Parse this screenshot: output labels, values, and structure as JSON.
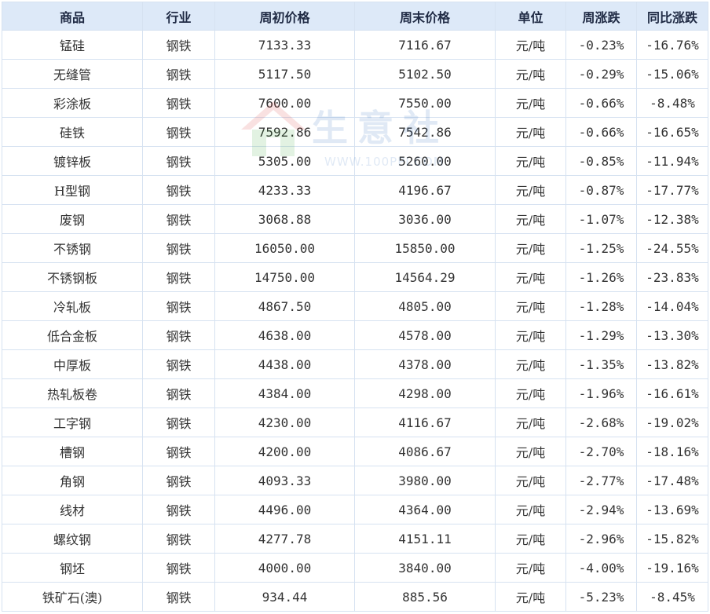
{
  "table": {
    "headers": [
      "商品",
      "行业",
      "周初价格",
      "周末价格",
      "单位",
      "周涨跌",
      "同比涨跌"
    ],
    "rows": [
      [
        "锰硅",
        "钢铁",
        "7133.33",
        "7116.67",
        "元/吨",
        "-0.23%",
        "-16.76%"
      ],
      [
        "无缝管",
        "钢铁",
        "5117.50",
        "5102.50",
        "元/吨",
        "-0.29%",
        "-15.06%"
      ],
      [
        "彩涂板",
        "钢铁",
        "7600.00",
        "7550.00",
        "元/吨",
        "-0.66%",
        "-8.48%"
      ],
      [
        "硅铁",
        "钢铁",
        "7592.86",
        "7542.86",
        "元/吨",
        "-0.66%",
        "-16.65%"
      ],
      [
        "镀锌板",
        "钢铁",
        "5305.00",
        "5260.00",
        "元/吨",
        "-0.85%",
        "-11.94%"
      ],
      [
        "H型钢",
        "钢铁",
        "4233.33",
        "4196.67",
        "元/吨",
        "-0.87%",
        "-17.77%"
      ],
      [
        "废钢",
        "钢铁",
        "3068.88",
        "3036.00",
        "元/吨",
        "-1.07%",
        "-12.38%"
      ],
      [
        "不锈钢",
        "钢铁",
        "16050.00",
        "15850.00",
        "元/吨",
        "-1.25%",
        "-24.55%"
      ],
      [
        "不锈钢板",
        "钢铁",
        "14750.00",
        "14564.29",
        "元/吨",
        "-1.26%",
        "-23.83%"
      ],
      [
        "冷轧板",
        "钢铁",
        "4867.50",
        "4805.00",
        "元/吨",
        "-1.28%",
        "-14.04%"
      ],
      [
        "低合金板",
        "钢铁",
        "4638.00",
        "4578.00",
        "元/吨",
        "-1.29%",
        "-13.30%"
      ],
      [
        "中厚板",
        "钢铁",
        "4438.00",
        "4378.00",
        "元/吨",
        "-1.35%",
        "-13.82%"
      ],
      [
        "热轧板卷",
        "钢铁",
        "4384.00",
        "4298.00",
        "元/吨",
        "-1.96%",
        "-16.61%"
      ],
      [
        "工字钢",
        "钢铁",
        "4230.00",
        "4116.67",
        "元/吨",
        "-2.68%",
        "-19.02%"
      ],
      [
        "槽钢",
        "钢铁",
        "4200.00",
        "4086.67",
        "元/吨",
        "-2.70%",
        "-18.16%"
      ],
      [
        "角钢",
        "钢铁",
        "4093.33",
        "3980.00",
        "元/吨",
        "-2.77%",
        "-17.48%"
      ],
      [
        "线材",
        "钢铁",
        "4496.00",
        "4364.00",
        "元/吨",
        "-2.94%",
        "-13.69%"
      ],
      [
        "螺纹钢",
        "钢铁",
        "4277.78",
        "4151.11",
        "元/吨",
        "-2.96%",
        "-15.82%"
      ],
      [
        "钢坯",
        "钢铁",
        "4000.00",
        "3840.00",
        "元/吨",
        "-4.00%",
        "-19.16%"
      ],
      [
        "铁矿石(澳)",
        "钢铁",
        "934.44",
        "885.56",
        "元/吨",
        "-5.23%",
        "-8.45%"
      ]
    ]
  },
  "watermark": {
    "text": "生意社",
    "url": "WWW.100PPI.COM",
    "icon": "house-logo-icon"
  },
  "colors": {
    "header_bg": "#dde9f8",
    "border": "#d6e2f1",
    "name_text": "#3a5da8",
    "change_text": "#1a8a2a",
    "body_text": "#333333"
  }
}
